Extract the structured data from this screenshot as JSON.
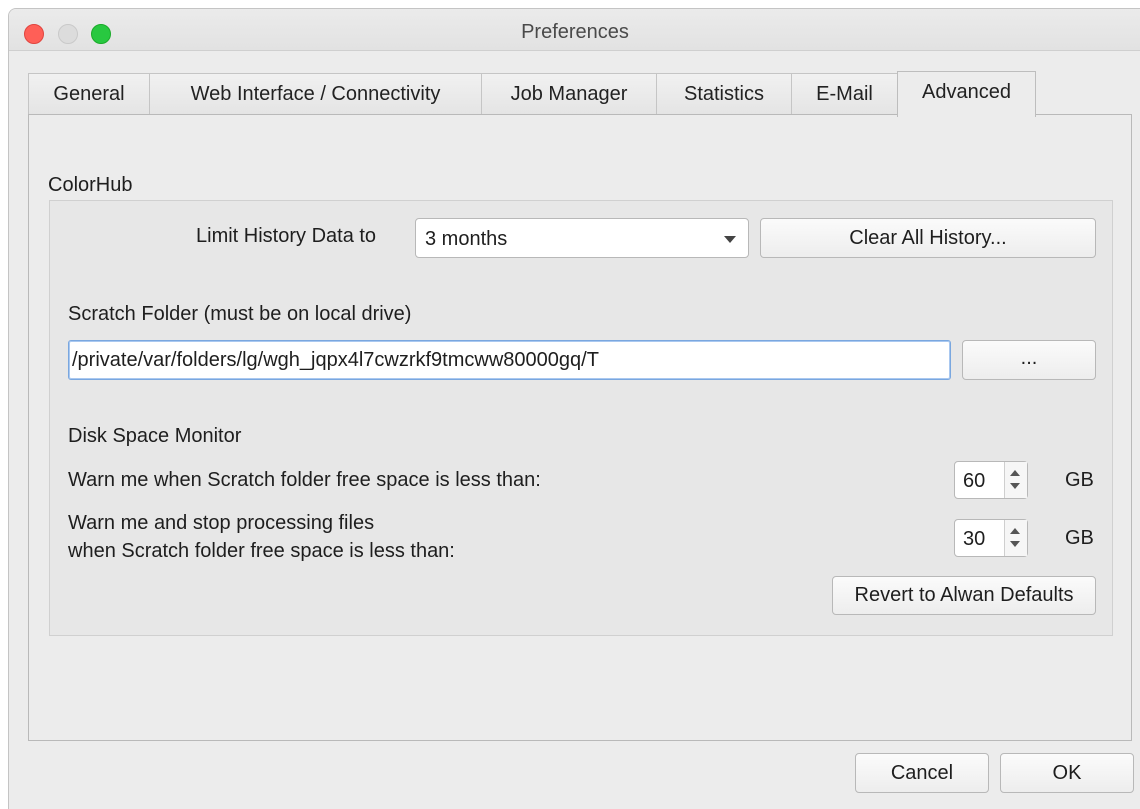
{
  "window": {
    "title": "Preferences"
  },
  "tabs": [
    {
      "label": "General"
    },
    {
      "label": "Web Interface / Connectivity"
    },
    {
      "label": "Job Manager"
    },
    {
      "label": "Statistics"
    },
    {
      "label": "E-Mail"
    },
    {
      "label": "Advanced"
    }
  ],
  "active_tab": "Advanced",
  "colorhub": {
    "section_title": "ColorHub",
    "limit_history_label": "Limit History Data to",
    "limit_history_value": "3 months",
    "clear_history_button": "Clear All History...",
    "scratch_label": "Scratch Folder (must be on local drive)",
    "scratch_path": "/private/var/folders/lg/wgh_jqpx4l7cwzrkf9tmcww80000gq/T",
    "browse_button": "...",
    "disk_monitor_title": "Disk Space Monitor",
    "warn_label": "Warn me when Scratch folder free space is less than:",
    "warn_value": "60",
    "warn_unit": "GB",
    "stop_label_line1": "Warn me and stop processing files",
    "stop_label_line2": "when Scratch folder free space is less than:",
    "stop_value": "30",
    "stop_unit": "GB",
    "revert_button": "Revert to Alwan Defaults"
  },
  "footer": {
    "cancel_button": "Cancel",
    "ok_button": "OK"
  },
  "colors": {
    "close": "#ff5f57",
    "minimize": "#dcdcdc",
    "maximize": "#28c840",
    "focus_ring": "#7aa7df"
  }
}
